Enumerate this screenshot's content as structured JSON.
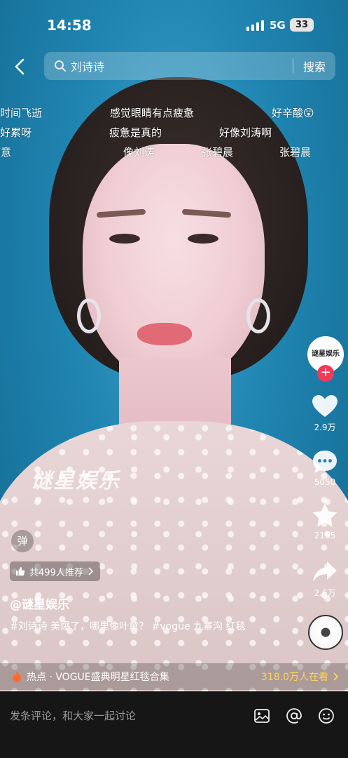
{
  "status_bar": {
    "time": "14:58",
    "network": "5G",
    "battery": "33"
  },
  "search": {
    "query": "刘诗诗",
    "button_label": "搜索"
  },
  "danmaku": [
    "时间飞逝",
    "感觉眼睛有点疲惫",
    "好辛酸😲",
    "好累呀",
    "疲惫是真的",
    "好像刘涛啊",
    "疲意",
    "像刘涛",
    "张碧晨",
    "张碧晨"
  ],
  "video": {
    "watermark": "谜星娱乐"
  },
  "creator": {
    "avatar_text": "谜星娱乐",
    "follow_symbol": "+"
  },
  "actions": {
    "likes": "2.9万",
    "comments": "5050",
    "favorites": "2165",
    "shares": "2.6万"
  },
  "info": {
    "danmu_toggle": "弹",
    "recommend": "共499人推荐",
    "author": "@谜星娱乐",
    "caption": "#刘诗诗 美爆了，哪里像叶童？ #vogue 九寨沟 红毯"
  },
  "hot_bar": {
    "label": "热点 · VOGUE盛典明星红毯合集",
    "views": "318.0万人在看"
  },
  "comment_bar": {
    "placeholder": "发条评论，和大家一起讨论"
  },
  "colors": {
    "accent_red": "#f03a5a",
    "hot_yellow": "#ffd54f",
    "bottom_bg": "#161616"
  }
}
